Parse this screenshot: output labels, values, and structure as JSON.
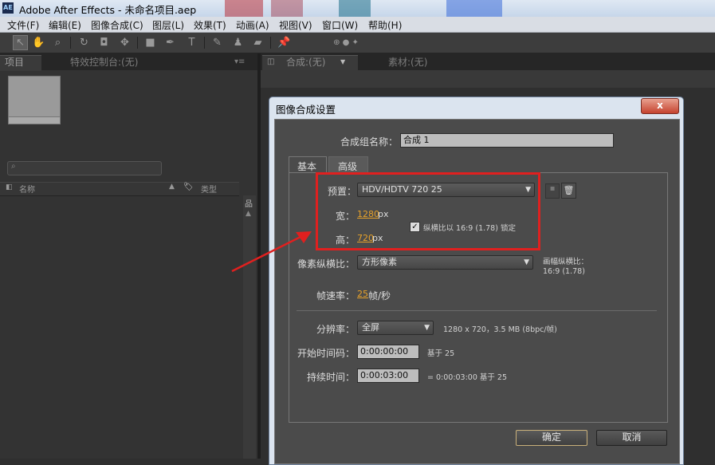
{
  "window": {
    "app_icon": "AE",
    "title": "Adobe After Effects - 未命名项目.aep"
  },
  "menu": [
    "文件(F)",
    "编辑(E)",
    "图像合成(C)",
    "图层(L)",
    "效果(T)",
    "动画(A)",
    "视图(V)",
    "窗口(W)",
    "帮助(H)"
  ],
  "toolbar": {
    "tools": [
      "selection-tool-icon",
      "hand-tool-icon",
      "zoom-tool-icon",
      "rotate-tool-icon",
      "camera-tool-icon",
      "pan-behind-tool-icon",
      "rectangle-tool-icon",
      "pen-tool-icon",
      "text-tool-icon",
      "brush-tool-icon",
      "clone-stamp-tool-icon",
      "eraser-tool-icon",
      "puppet-pin-tool-icon"
    ]
  },
  "left_panel": {
    "tab_project": "项目",
    "tab_effects": "特效控制台:(无)",
    "col_name": "名称",
    "col_type": "类型"
  },
  "right_panel": {
    "tab_comp": "合成:(无)",
    "tab_footage": "素材:(无)"
  },
  "dialog": {
    "title": "图像合成设置",
    "close": "x",
    "comp_name_label": "合成组名称：",
    "comp_name_value": "合成 1",
    "tab_basic": "基本",
    "tab_advanced": "高级",
    "preset_label": "预置：",
    "preset_value": "HDV/HDTV 720 25",
    "width_label": "宽：",
    "width_value": "1280",
    "width_unit": "px",
    "height_label": "高：",
    "height_value": "720",
    "height_unit": "px",
    "lock_aspect_label": "纵横比以 16:9 (1.78) 锁定",
    "lock_aspect_checked": true,
    "pixel_aspect_label": "像素纵横比：",
    "pixel_aspect_value": "方形像素",
    "frame_aspect_label": "画幅纵横比：",
    "frame_aspect_value": "16:9 (1.78)",
    "frame_rate_label": "帧速率：",
    "frame_rate_value": "25",
    "frame_rate_unit": "帧/秒",
    "resolution_label": "分辨率：",
    "resolution_value": "全屏",
    "resolution_info": "1280 x 720，3.5 MB (8bpc/帧)",
    "start_tc_label": "开始时间码：",
    "start_tc_value": "0:00:00:00",
    "start_tc_base": "基于 25",
    "duration_label": "持续时间：",
    "duration_value": "0:00:03:00",
    "duration_info": "= 0:00:03:00  基于 25",
    "ok": "确定",
    "cancel": "取消"
  },
  "colors": {
    "highlight_box": "#e0201f",
    "value_orange": "#e6a12a",
    "arrow": "#e0201f"
  }
}
